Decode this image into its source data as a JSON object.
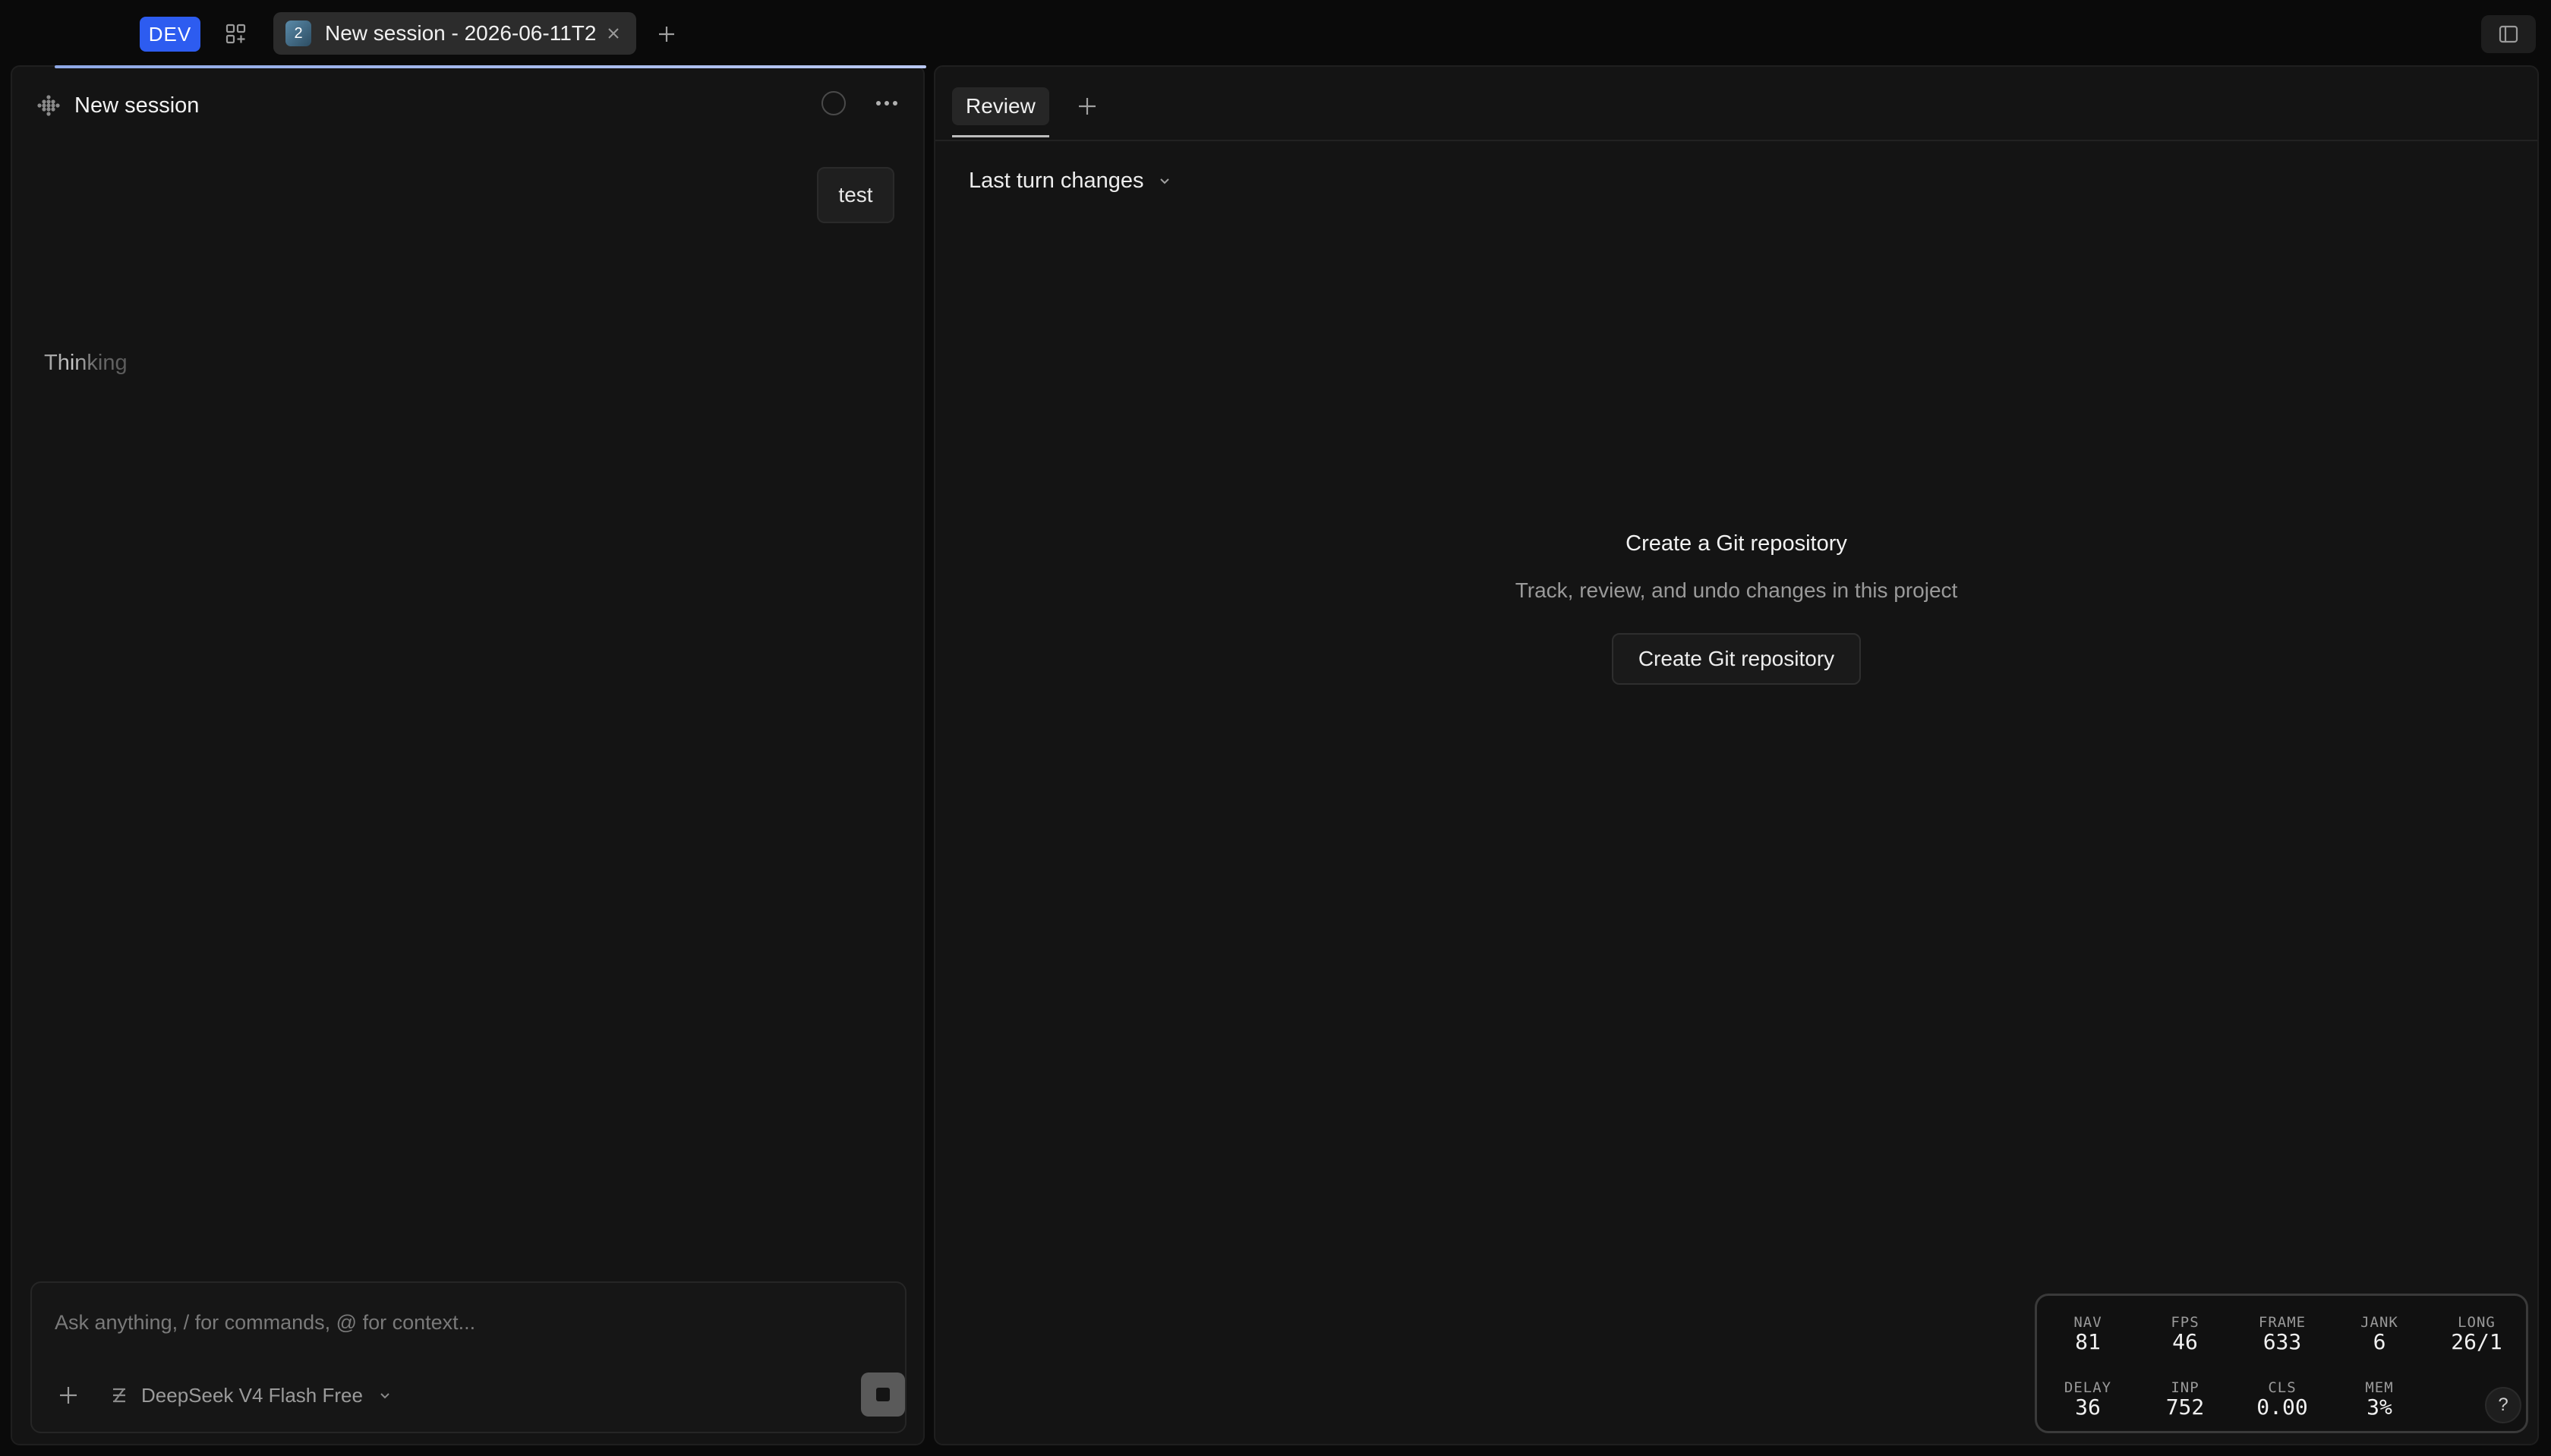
{
  "topbar": {
    "env_badge": "DEV",
    "tab": {
      "avatar_text": "2",
      "label": "New session - 2026-06-11T2"
    }
  },
  "session": {
    "title": "New session",
    "user_message": "test",
    "status_text": "Thinking"
  },
  "composer": {
    "placeholder": "Ask anything, / for commands, @ for context...",
    "model": "DeepSeek V4 Flash Free"
  },
  "review": {
    "tab_label": "Review",
    "changes_selector": "Last turn changes",
    "empty_title": "Create a Git repository",
    "empty_description": "Track, review, and undo changes in this project",
    "create_button": "Create Git repository"
  },
  "perf": {
    "nav": {
      "key": "NAV",
      "value": "81"
    },
    "fps": {
      "key": "FPS",
      "value": "46"
    },
    "frame": {
      "key": "FRAME",
      "value": "633"
    },
    "jank": {
      "key": "JANK",
      "value": "6"
    },
    "long": {
      "key": "LONG",
      "value": "26/1"
    },
    "delay": {
      "key": "DELAY",
      "value": "36"
    },
    "inp": {
      "key": "INP",
      "value": "752"
    },
    "cls": {
      "key": "CLS",
      "value": "0.00"
    },
    "mem": {
      "key": "MEM",
      "value": "3%"
    },
    "help": "?"
  },
  "colors": {
    "accent": "#2d5cf0",
    "background": "#0a0a0a",
    "panel": "#141414"
  },
  "icons": [
    "apps-add-icon",
    "close-icon",
    "plus-icon",
    "sidebar-toggle-icon",
    "session-dots-icon",
    "status-circle-icon",
    "more-horizontal-icon",
    "chevron-down-icon",
    "model-logo-icon",
    "stop-icon"
  ]
}
